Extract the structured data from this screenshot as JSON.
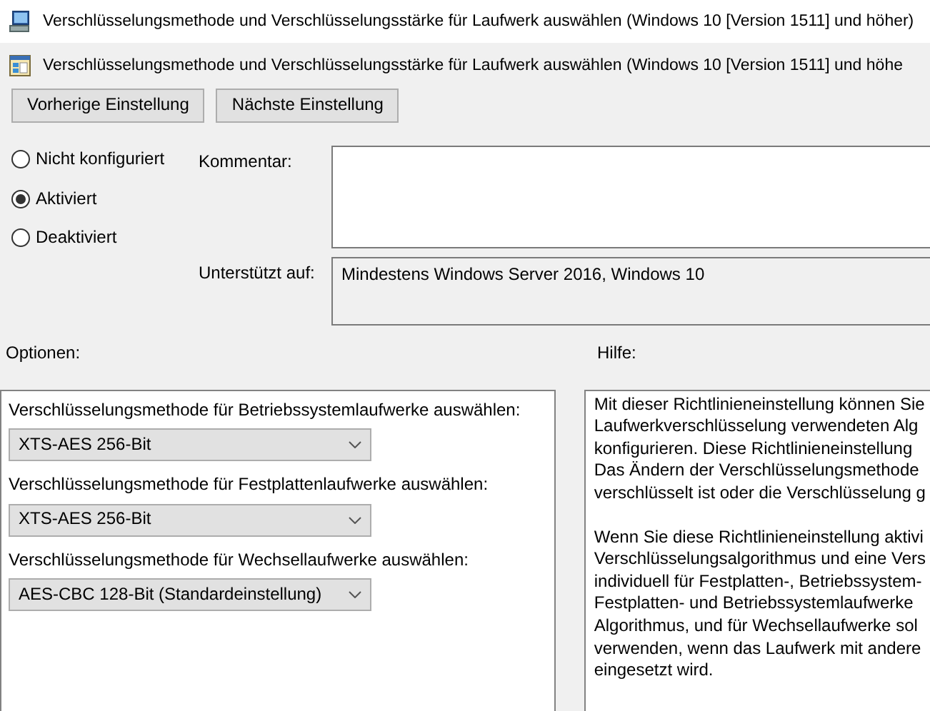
{
  "window": {
    "title": "Verschlüsselungsmethode und Verschlüsselungsstärke für Laufwerk auswählen (Windows 10 [Version 1511] und höher)"
  },
  "policy_title": "Verschlüsselungsmethode und Verschlüsselungsstärke für Laufwerk auswählen (Windows 10 [Version 1511] und höhe",
  "buttons": [
    "Vorherige Einstellung",
    "Nächste Einstellung"
  ],
  "radios": [
    {
      "label": "Nicht konfiguriert",
      "selected": false
    },
    {
      "label": "Aktiviert",
      "selected": true
    },
    {
      "label": "Deaktiviert",
      "selected": false
    }
  ],
  "comment": {
    "label": "Kommentar:"
  },
  "supported": {
    "label": "Unterstützt auf:",
    "value": "Mindestens Windows Server 2016, Windows 10"
  },
  "options": {
    "label": "Optionen:",
    "fields": [
      {
        "label": "Verschlüsselungsmethode für Betriebssystemlaufwerke auswählen:",
        "value": "XTS-AES 256-Bit"
      },
      {
        "label": "Verschlüsselungsmethode für Festplattenlaufwerke auswählen:",
        "value": "XTS-AES 256-Bit"
      },
      {
        "label": "Verschlüsselungsmethode für Wechsellaufwerke auswählen:",
        "value": "AES-CBC 128-Bit (Standardeinstellung)"
      }
    ]
  },
  "help": {
    "label": "Hilfe:",
    "paragraphs": [
      [
        "Mit dieser Richtlinieneinstellung können Sie",
        "Laufwerkverschlüsselung verwendeten Alg",
        "konfigurieren. Diese Richtlinieneinstellung",
        "Das Ändern der Verschlüsselungsmethode",
        "verschlüsselt ist oder die Verschlüsselung g"
      ],
      [
        "Wenn Sie diese Richtlinieneinstellung aktivi",
        "Verschlüsselungsalgorithmus und eine Vers",
        "individuell für Festplatten-, Betriebssystem-",
        "Festplatten- und Betriebssystemlaufwerke",
        "Algorithmus, und für Wechsellaufwerke sol",
        "verwenden, wenn das Laufwerk mit andere",
        "eingesetzt wird."
      ]
    ]
  }
}
